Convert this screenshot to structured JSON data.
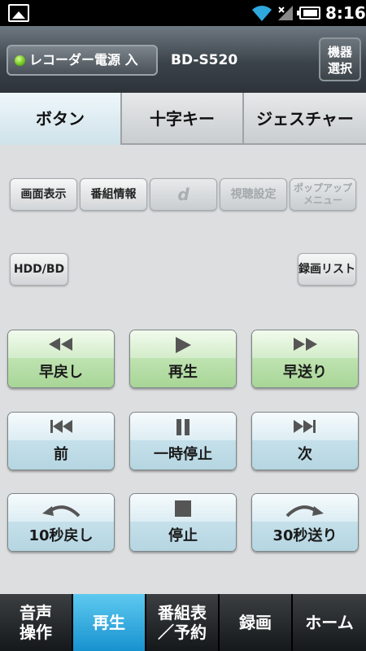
{
  "status_bar": {
    "time": "8:16"
  },
  "header": {
    "power_label": "レコーダー電源 入",
    "model": "BD-S520",
    "device_select_line1": "機器",
    "device_select_line2": "選択"
  },
  "tabs": [
    {
      "label": "ボタン",
      "active": true
    },
    {
      "label": "十字キー",
      "active": false
    },
    {
      "label": "ジェスチャー",
      "active": false
    }
  ],
  "small_buttons": {
    "screen_display": "画面表示",
    "program_info": "番組情報",
    "d_button": "d",
    "viewing_settings": "視聴設定",
    "popup_menu_line1": "ポップアップ",
    "popup_menu_line2": "メニュー",
    "hdd_bd": "HDD/BD",
    "recording_list": "録画リスト"
  },
  "playback": {
    "rewind": "早戻し",
    "play": "再生",
    "fast_forward": "早送り",
    "previous": "前",
    "pause": "一時停止",
    "next": "次",
    "skip_back": "10秒戻し",
    "stop": "停止",
    "skip_forward": "30秒送り"
  },
  "bottom_nav": {
    "voice_line1": "音声",
    "voice_line2": "操作",
    "play": "再生",
    "epg_line1": "番組表",
    "epg_line2": "／予約",
    "record": "録画",
    "home": "ホーム"
  },
  "colors": {
    "active_nav": "#1792cf",
    "green_button": "#a6d595",
    "blue_button": "#b4d5e1"
  }
}
